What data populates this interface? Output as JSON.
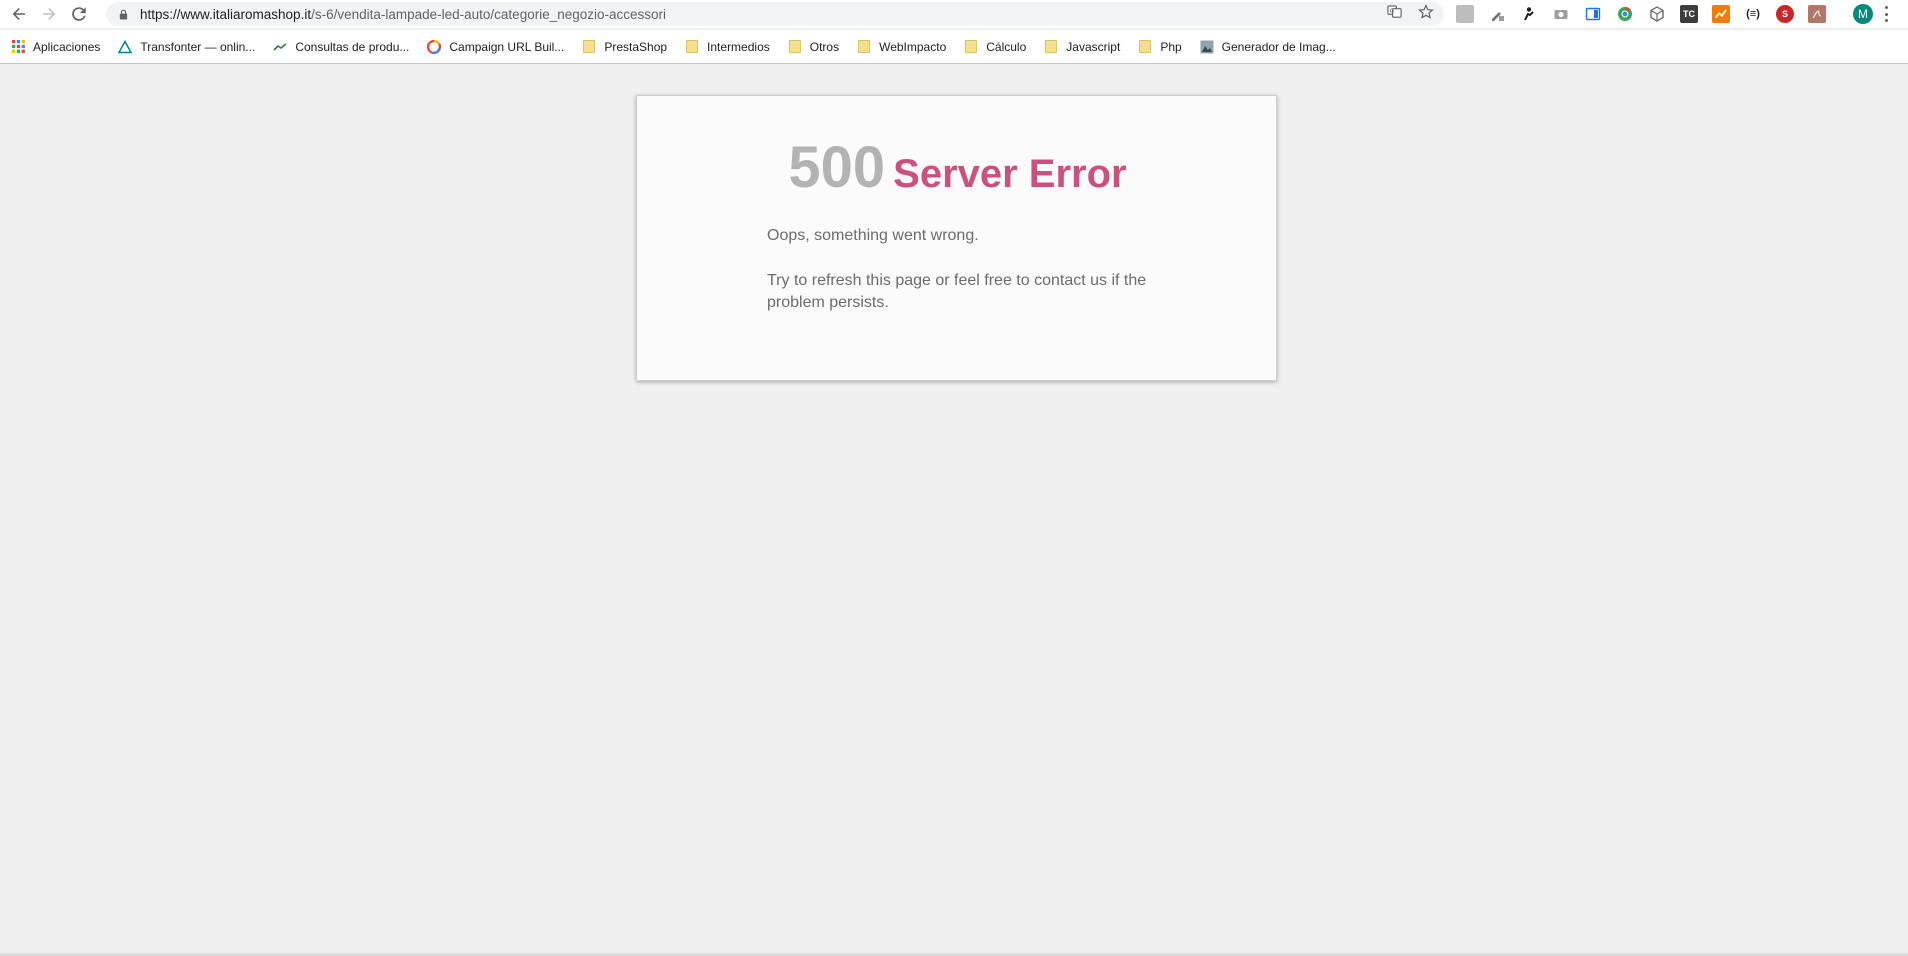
{
  "browser": {
    "url_host": "https://www.italiaromashop.it",
    "url_path": "/s-6/vendita-lampade-led-auto/categorie_negozio-accessori",
    "profile_initial": "M",
    "accent_profile_color": "#00897b"
  },
  "bookmarks": [
    {
      "label": "Aplicaciones",
      "icon": "apps-grid-icon"
    },
    {
      "label": "Transfonter — onlin...",
      "icon": "triangle-icon"
    },
    {
      "label": "Consultas de produ...",
      "icon": "trend-icon"
    },
    {
      "label": "Campaign URL Buil...",
      "icon": "google-icon"
    },
    {
      "label": "PrestaShop",
      "icon": "folder-icon"
    },
    {
      "label": "Intermedios",
      "icon": "folder-icon"
    },
    {
      "label": "Otros",
      "icon": "folder-icon"
    },
    {
      "label": "WebImpacto",
      "icon": "folder-icon"
    },
    {
      "label": "Cálculo",
      "icon": "folder-icon"
    },
    {
      "label": "Javascript",
      "icon": "folder-icon"
    },
    {
      "label": "Php",
      "icon": "folder-icon"
    },
    {
      "label": "Generador de Imag...",
      "icon": "image-generator-icon"
    }
  ],
  "error": {
    "code": "500",
    "label": "Server Error",
    "message": "Oops, something went wrong.",
    "detail": "Try to refresh this page or feel free to contact us if the problem persists.",
    "code_color": "#b3b3b3",
    "label_color": "#c9527f"
  }
}
